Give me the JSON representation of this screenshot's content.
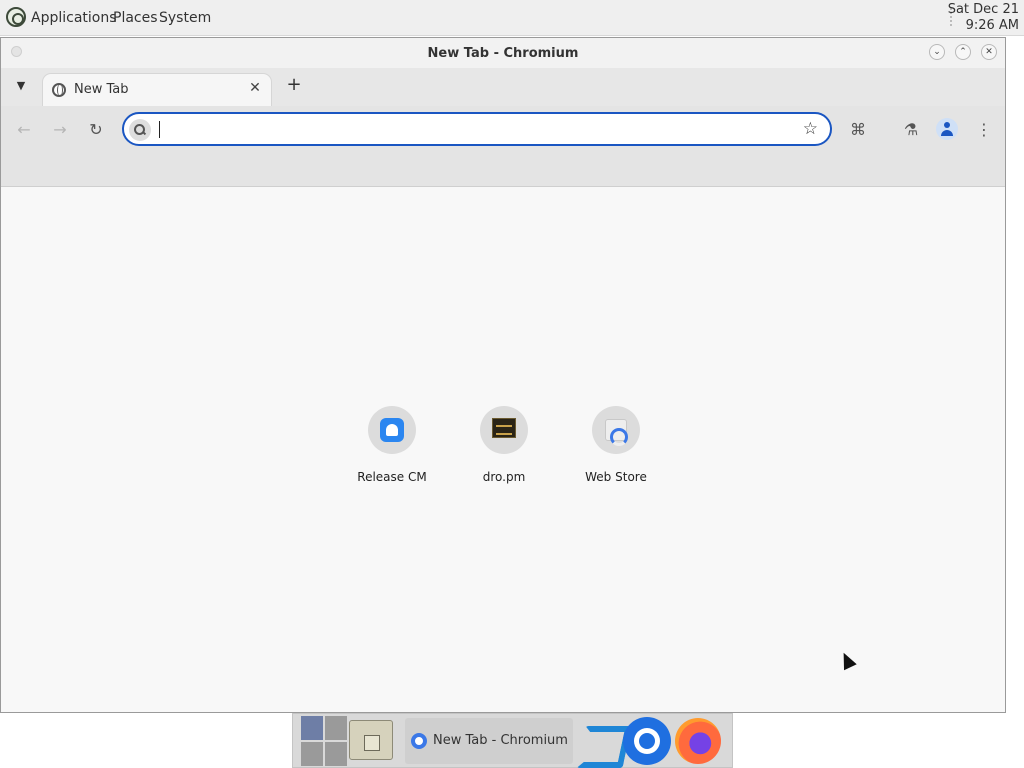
{
  "top_panel": {
    "menus": [
      "Applications",
      "Places",
      "System"
    ],
    "clock_date": "Sat Dec 21",
    "clock_time": "9:26 AM"
  },
  "window": {
    "title": "New Tab - Chromium",
    "controls": [
      "minimize",
      "maximize",
      "close"
    ]
  },
  "tabs": {
    "search_icon": "chevron-down-icon",
    "items": [
      {
        "title": "New Tab",
        "active": true
      }
    ],
    "new_tab_icon": "plus-icon"
  },
  "toolbar": {
    "back_icon": "arrow-left-icon",
    "forward_icon": "arrow-right-icon",
    "reload_icon": "reload-icon",
    "omnibox": {
      "value": "",
      "placeholder": ""
    },
    "right_icons": [
      "extensions-icon",
      "labs-icon",
      "profile-icon",
      "menu-icon"
    ]
  },
  "ntp": {
    "shortcuts": [
      {
        "title": "Release CM",
        "icon": "android-icon"
      },
      {
        "title": "dro.pm",
        "icon": "dro-icon"
      },
      {
        "title": "Web Store",
        "icon": "web-store-icon"
      }
    ]
  },
  "taskbar": {
    "workspaces": 4,
    "active_workspace": 1,
    "task_label": "New Tab - Chromium",
    "launchers": [
      "files-icon",
      "vscode-icon",
      "chromium-icon",
      "firefox-icon"
    ]
  },
  "colors": {
    "accent": "#1a56c2",
    "panel_bg": "#efefef",
    "toolbar_bg": "#e4e4e4",
    "page_bg": "#f8f8f8"
  }
}
